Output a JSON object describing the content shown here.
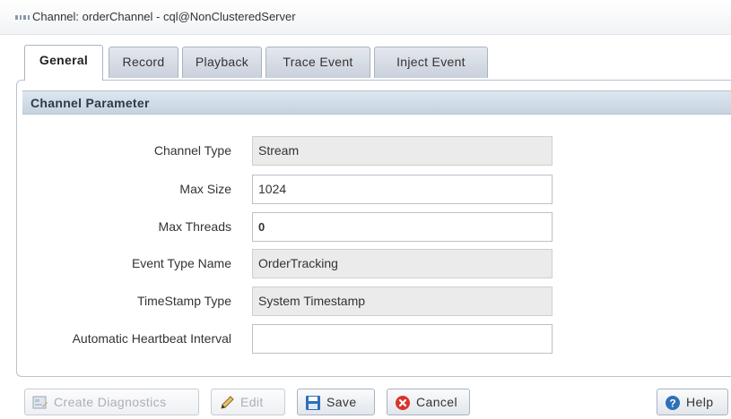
{
  "window": {
    "title": "Channel: orderChannel - cql@NonClusteredServer",
    "icon": "dots-icon"
  },
  "tabs": [
    {
      "label": "General",
      "active": true
    },
    {
      "label": "Record",
      "active": false
    },
    {
      "label": "Playback",
      "active": false
    },
    {
      "label": "Trace Event",
      "active": false
    },
    {
      "label": "Inject Event",
      "active": false
    }
  ],
  "section": {
    "title": "Channel Parameter"
  },
  "fields": {
    "channel_type": {
      "label": "Channel Type",
      "value": "Stream"
    },
    "max_size": {
      "label": "Max Size",
      "value": "1024"
    },
    "max_threads": {
      "label": "Max Threads",
      "value": "0"
    },
    "event_type_name": {
      "label": "Event Type Name",
      "value": "OrderTracking"
    },
    "timestamp_type": {
      "label": "TimeStamp Type",
      "value": "System Timestamp"
    },
    "heartbeat_interval": {
      "label": "Automatic Heartbeat Interval",
      "value": ""
    }
  },
  "toolbar": {
    "create_diagnostics": "Create Diagnostics",
    "edit": "Edit",
    "save": "Save",
    "cancel": "Cancel",
    "help": "Help"
  },
  "colors": {
    "accent_blue": "#2f6fb8",
    "cancel_red": "#d9342b",
    "header_bg": "#c6d3e0"
  }
}
